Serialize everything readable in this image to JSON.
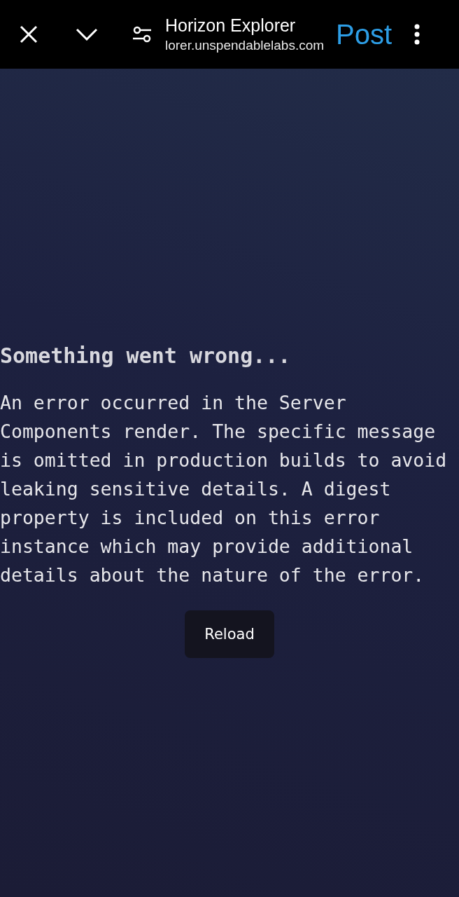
{
  "toolbar": {
    "title": "Horizon Explorer",
    "url": "lorer.unspendablelabs.com",
    "action": "Post"
  },
  "error": {
    "heading": "Something went wrong...",
    "message": "An error occurred in the Server Components render. The specific message is omitted in production builds to avoid leaking sensitive details. A digest property is included on this error instance which may provide additional details about the nature of the error.",
    "button": "Reload"
  }
}
